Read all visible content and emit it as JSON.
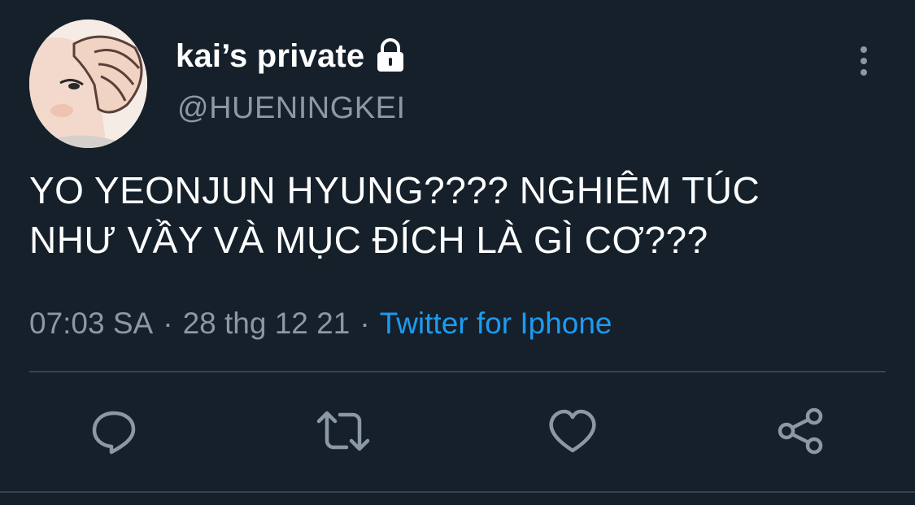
{
  "user": {
    "display_name": "kai’s private",
    "handle": "@HUENINGKEI",
    "protected_icon": "lock-icon",
    "avatar": "avatar-illustration"
  },
  "tweet": {
    "text_line_1": "YO YEONJUN HYUNG???? NGHIÊM TÚC",
    "text_line_2": "NHƯ VẦY VÀ MỤC ĐÍCH LÀ GÌ CƠ???",
    "time": "07:03 SA",
    "separator_1": "·",
    "date": "28 thg 12 21",
    "separator_2": "·",
    "source": "Twitter for Iphone"
  },
  "actions": [
    {
      "name": "reply",
      "icon": "reply-icon"
    },
    {
      "name": "retweet",
      "icon": "retweet-icon"
    },
    {
      "name": "like",
      "icon": "heart-icon"
    },
    {
      "name": "share",
      "icon": "share-icon"
    }
  ],
  "colors": {
    "background": "#15202b",
    "primary_text": "#ffffff",
    "secondary_text": "#8b98a5",
    "link": "#1d9bf0",
    "divider": "#38444d"
  }
}
